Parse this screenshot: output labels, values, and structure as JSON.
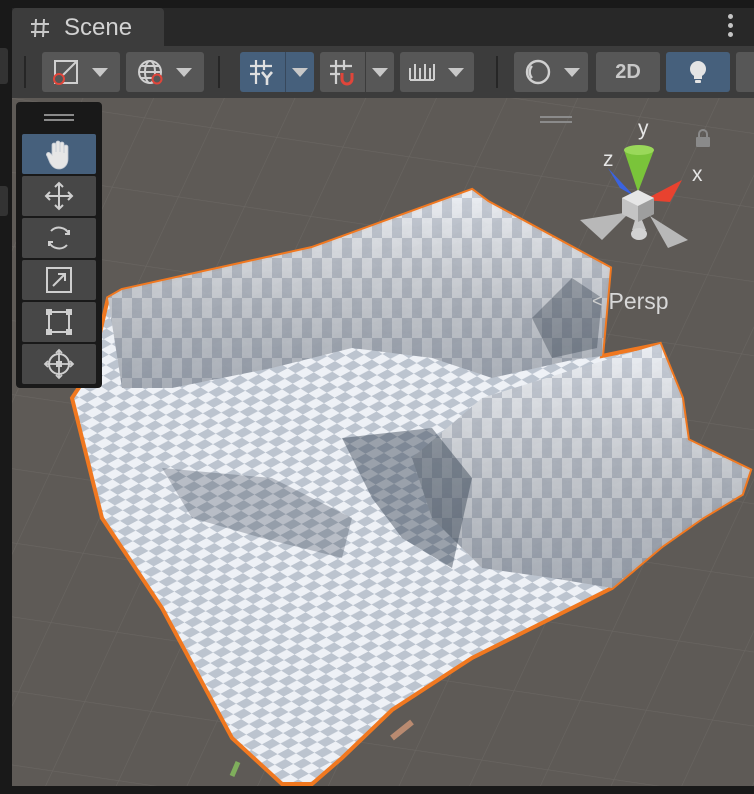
{
  "tab": {
    "title": "Scene",
    "icon": "scene-hash-icon",
    "menu_icon": "kebab-menu-icon"
  },
  "toolbar": {
    "draw_mode": {
      "icon": "shaded-draw-mode-icon"
    },
    "global_toggle": {
      "icon": "globe-icon"
    },
    "grid_snapping": {
      "icon": "grid-y-icon",
      "active": true
    },
    "increment_snap": {
      "icon": "snap-magnet-icon"
    },
    "ruler": {
      "icon": "ruler-icon"
    },
    "render_mode": {
      "icon": "render-sphere-icon"
    },
    "mode_2d_label": "2D",
    "lighting": {
      "icon": "light-bulb-icon",
      "active": true
    }
  },
  "tools": [
    {
      "name": "hand",
      "icon": "hand-icon",
      "selected": true
    },
    {
      "name": "move",
      "icon": "move-icon",
      "selected": false
    },
    {
      "name": "rotate",
      "icon": "rotate-icon",
      "selected": false
    },
    {
      "name": "scale",
      "icon": "scale-icon",
      "selected": false
    },
    {
      "name": "rect",
      "icon": "rect-transform-icon",
      "selected": false
    },
    {
      "name": "transform",
      "icon": "transform-icon",
      "selected": false
    }
  ],
  "gizmo": {
    "x_label": "x",
    "y_label": "y",
    "z_label": "z",
    "projection": "Persp"
  },
  "colors": {
    "accent": "#46607c",
    "selection_outline": "#f07820",
    "x_axis": "#e8422f",
    "y_axis": "#7ac43a",
    "z_axis": "#3a63e0"
  }
}
